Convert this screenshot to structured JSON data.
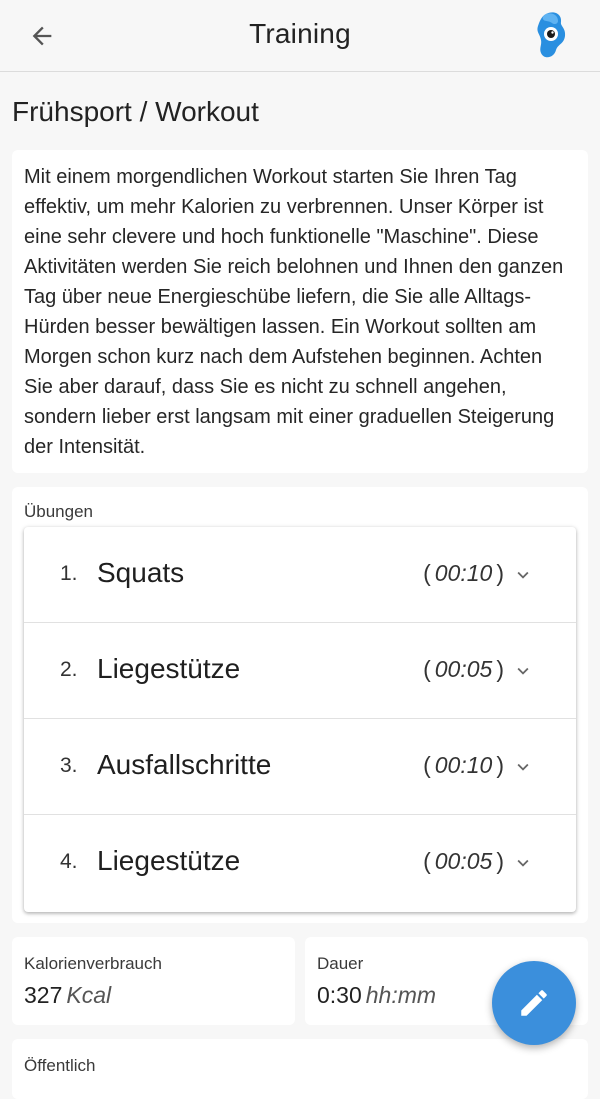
{
  "appbar": {
    "title": "Training",
    "back_icon": "arrow-left-icon",
    "logo_icon": "app-logo-icon"
  },
  "page": {
    "title": "Frühsport / Workout"
  },
  "description": "Mit einem morgendlichen Workout starten Sie Ihren Tag effektiv, um mehr Kalorien zu verbrennen. Unser Körper ist eine sehr clevere und hoch funktionelle \"Maschine\". Diese Aktivitäten werden Sie reich belohnen und Ihnen den ganzen Tag über neue Energieschübe liefern, die Sie alle Alltags-Hürden besser bewältigen lassen. Ein Workout sollten am Morgen schon kurz nach dem Aufstehen beginnen. Achten Sie aber darauf, dass Sie es nicht zu schnell angehen, sondern lieber erst langsam mit einer graduellen Steigerung der Intensität.",
  "exercises": {
    "label": "Übungen",
    "items": [
      {
        "num": "1.",
        "name": "Squats",
        "open": "(",
        "time": "00:10",
        "close": ")"
      },
      {
        "num": "2.",
        "name": "Liegestütze",
        "open": "(",
        "time": "00:05",
        "close": ")"
      },
      {
        "num": "3.",
        "name": "Ausfallschritte",
        "open": "(",
        "time": "00:10",
        "close": ")"
      },
      {
        "num": "4.",
        "name": "Liegestütze",
        "open": "(",
        "time": "00:05",
        "close": ")"
      }
    ]
  },
  "calories": {
    "label": "Kalorienverbrauch",
    "value": "327",
    "unit": "Kcal"
  },
  "duration": {
    "label": "Dauer",
    "value": "0:30",
    "unit": "hh:mm"
  },
  "public": {
    "label": "Öffentlich"
  },
  "fab": {
    "icon": "pencil-icon"
  },
  "colors": {
    "accent": "#3b8fdc",
    "background": "#f7f7f7",
    "card": "#ffffff"
  }
}
